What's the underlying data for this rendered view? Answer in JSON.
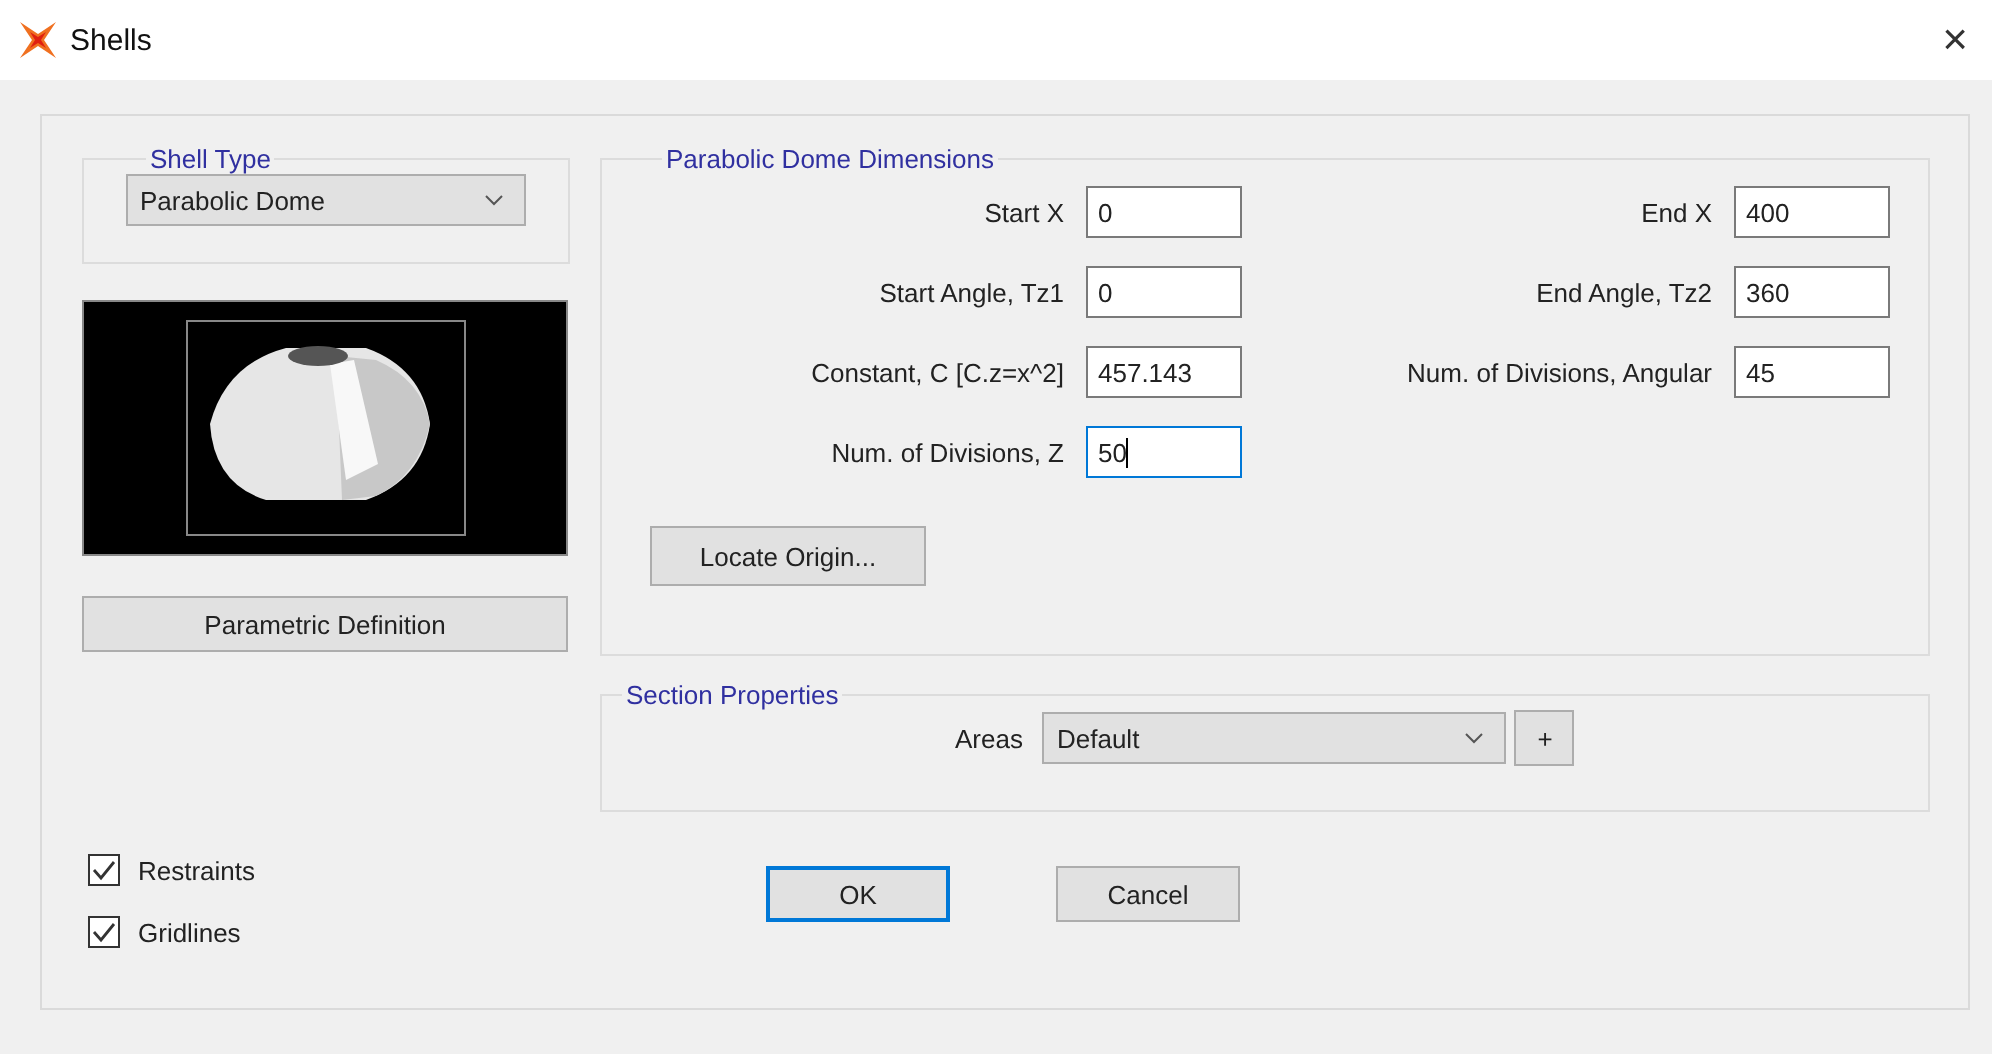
{
  "window": {
    "title": "Shells",
    "close": "×"
  },
  "shell_type": {
    "legend": "Shell Type",
    "value": "Parabolic Dome"
  },
  "parametric_button": "Parametric Definition",
  "checkboxes": [
    {
      "label": "Restraints",
      "checked": true
    },
    {
      "label": "Gridlines",
      "checked": true
    }
  ],
  "dimensions": {
    "legend": "Parabolic Dome Dimensions",
    "fields": [
      {
        "label": "Start X",
        "value": "0",
        "focused": false
      },
      {
        "label": "End X",
        "value": "400",
        "focused": false
      },
      {
        "label": "Start Angle, Tz1",
        "value": "0",
        "focused": false
      },
      {
        "label": "End Angle, Tz2",
        "value": "360",
        "focused": false
      },
      {
        "label": "Constant, C [C.z=x^2]",
        "value": "457.143",
        "focused": false
      },
      {
        "label": "Num. of Divisions, Angular",
        "value": "45",
        "focused": false
      },
      {
        "label": "Num. of Divisions, Z",
        "value": "50",
        "focused": true
      }
    ],
    "locate_button": "Locate Origin..."
  },
  "section": {
    "legend": "Section Properties",
    "areas_label": "Areas",
    "areas_value": "Default",
    "add_button": "+"
  },
  "buttons": [
    {
      "label": "OK",
      "default": true
    },
    {
      "label": "Cancel",
      "default": false
    }
  ]
}
